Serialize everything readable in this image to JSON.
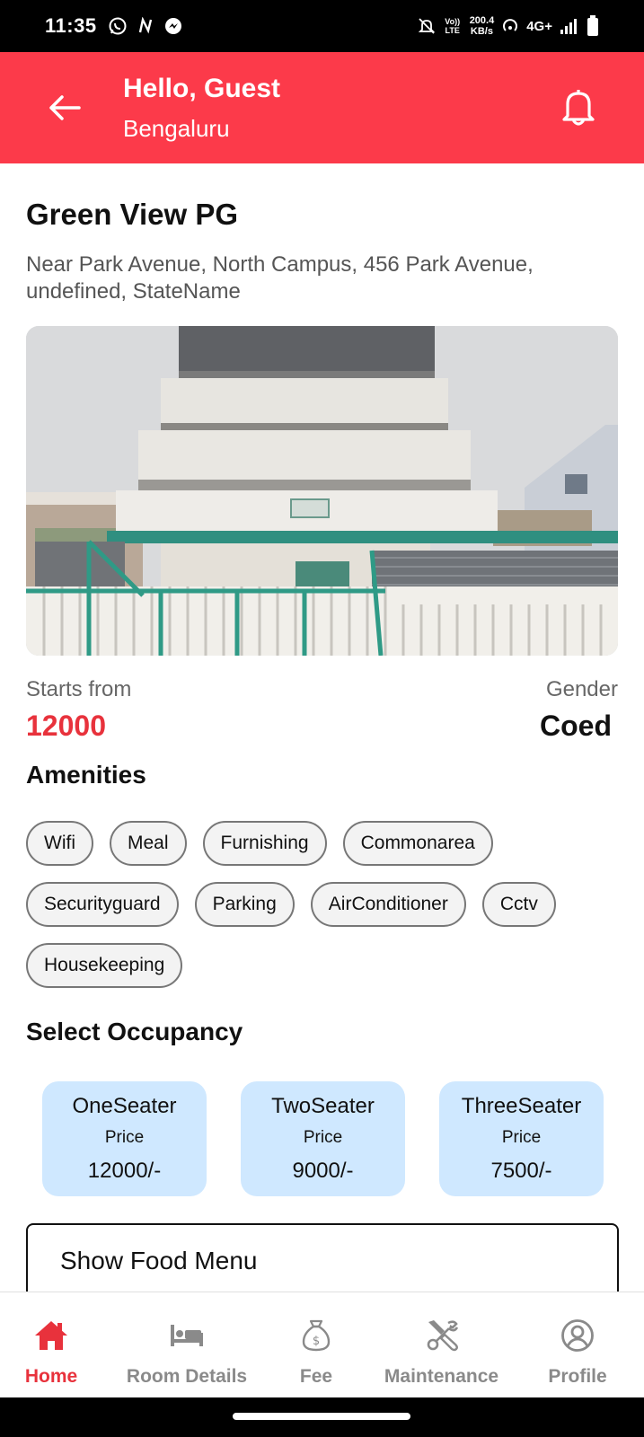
{
  "status_bar": {
    "time": "11:35",
    "net_speed_value": "200.4",
    "net_speed_unit": "KB/s",
    "network": "4G+",
    "volte": "Vo)) LTE"
  },
  "header": {
    "greeting": "Hello, Guest",
    "city": "Bengaluru",
    "bg_color": "#fc3a4a"
  },
  "property": {
    "name": "Green View PG",
    "address": "Near Park Avenue, North Campus, 456 Park Avenue, undefined, StateName",
    "price_label": "Starts from",
    "price_value": "12000",
    "gender_label": "Gender",
    "gender_value": "Coed"
  },
  "amenities": {
    "title": "Amenities",
    "items": [
      "Wifi",
      "Meal",
      "Furnishing",
      "Commonarea",
      "Securityguard",
      "Parking",
      "AirConditioner",
      "Cctv",
      "Housekeeping"
    ]
  },
  "occupancy": {
    "title": "Select Occupancy",
    "options": [
      {
        "name": "OneSeater",
        "price_label": "Price",
        "price": "12000/-"
      },
      {
        "name": "TwoSeater",
        "price_label": "Price",
        "price": "9000/-"
      },
      {
        "name": "ThreeSeater",
        "price_label": "Price",
        "price": "7500/-"
      }
    ]
  },
  "food_menu_button": "Show Food Menu",
  "bottom_nav": {
    "items": [
      {
        "label": "Home",
        "icon": "home-icon",
        "active": true
      },
      {
        "label": "Room Details",
        "icon": "bed-icon",
        "active": false
      },
      {
        "label": "Fee",
        "icon": "money-bag-icon",
        "active": false
      },
      {
        "label": "Maintenance",
        "icon": "tools-icon",
        "active": false
      },
      {
        "label": "Profile",
        "icon": "profile-icon",
        "active": false
      }
    ],
    "active_color": "#e8323c",
    "inactive_color": "#8a8a8a"
  }
}
